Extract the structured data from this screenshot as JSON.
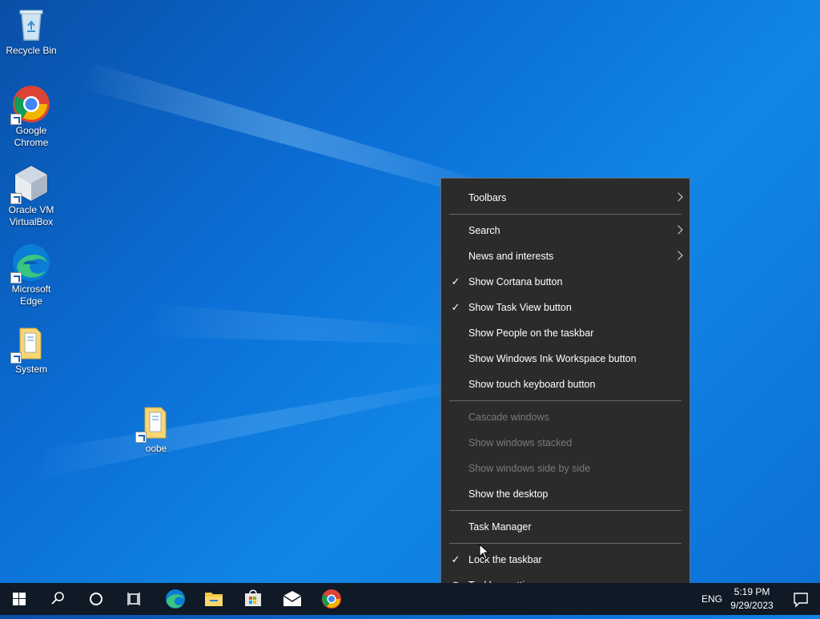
{
  "desktop": {
    "icons": [
      {
        "label": "Recycle Bin"
      },
      {
        "label": "Google Chrome"
      },
      {
        "label": "Oracle VM VirtualBox"
      },
      {
        "label": "Microsoft Edge"
      },
      {
        "label": "System"
      },
      {
        "label": "oobe"
      }
    ]
  },
  "context_menu": {
    "items": [
      {
        "label": "Toolbars",
        "submenu": true
      },
      {
        "label": "Search",
        "submenu": true
      },
      {
        "label": "News and interests",
        "submenu": true
      },
      {
        "label": "Show Cortana button",
        "checked": true
      },
      {
        "label": "Show Task View button",
        "checked": true
      },
      {
        "label": "Show People on the taskbar"
      },
      {
        "label": "Show Windows Ink Workspace button"
      },
      {
        "label": "Show touch keyboard button"
      },
      {
        "label": "Cascade windows",
        "disabled": true
      },
      {
        "label": "Show windows stacked",
        "disabled": true
      },
      {
        "label": "Show windows side by side",
        "disabled": true
      },
      {
        "label": "Show the desktop"
      },
      {
        "label": "Task Manager"
      },
      {
        "label": "Lock the taskbar",
        "checked": true
      },
      {
        "label": "Taskbar settings",
        "icon": "gear-icon"
      }
    ],
    "check_glyph": "✓"
  },
  "taskbar": {
    "pinned": [
      "start-icon",
      "search-icon",
      "cortana-icon",
      "task-view-icon",
      "edge-icon",
      "file-explorer-icon",
      "store-icon",
      "mail-icon",
      "chrome-icon"
    ],
    "language": "ENG",
    "time": "5:19 PM",
    "date": "9/29/2023"
  },
  "colors": {
    "menu_bg": "#2b2b2b",
    "taskbar_bg": "#101a26",
    "disabled_text": "#7a7a7a"
  }
}
